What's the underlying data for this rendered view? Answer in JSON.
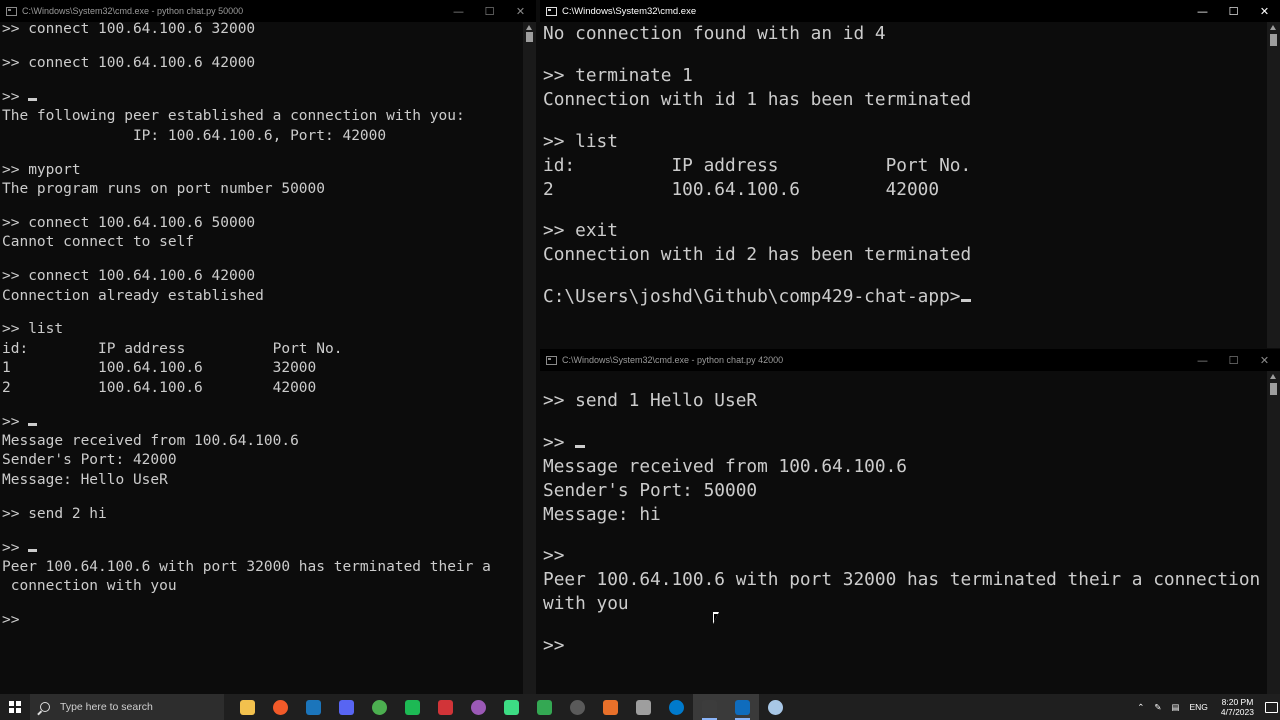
{
  "windows": {
    "left": {
      "title": "C:\\Windows\\System32\\cmd.exe - python  chat.py 50000",
      "controls": {
        "minimize": "—",
        "maximize": "☐",
        "close": "✕"
      },
      "lines": [
        ">> connect 100.64.100.6 32000",
        "",
        ">> connect 100.64.100.6 42000",
        "",
        ">> ",
        "The following peer established a connection with you:",
        "               IP: 100.64.100.6, Port: 42000",
        "",
        ">> myport",
        "The program runs on port number 50000",
        "",
        ">> connect 100.64.100.6 50000",
        "Cannot connect to self",
        "",
        ">> connect 100.64.100.6 42000",
        "Connection already established",
        "",
        ">> list",
        "id:        IP address          Port No.",
        "1          100.64.100.6        32000",
        "2          100.64.100.6        42000",
        "",
        ">> ",
        "Message received from 100.64.100.6",
        "Sender's Port: 42000",
        "Message: Hello UseR",
        "",
        ">> send 2 hi",
        "",
        ">> ",
        "Peer 100.64.100.6 with port 32000 has terminated their a",
        " connection with you",
        "",
        ">>"
      ]
    },
    "top_right": {
      "title": "C:\\Windows\\System32\\cmd.exe",
      "controls": {
        "minimize": "—",
        "maximize": "☐",
        "close": "✕"
      },
      "lines": [
        "No connection found with an id 4",
        "",
        ">> terminate 1",
        "Connection with id 1 has been terminated",
        "",
        ">> list",
        "id:         IP address          Port No.",
        "2           100.64.100.6        42000",
        "",
        ">> exit",
        "Connection with id 2 has been terminated",
        "",
        "C:\\Users\\joshd\\Github\\comp429-chat-app>"
      ]
    },
    "bottom_right": {
      "title": "C:\\Windows\\System32\\cmd.exe - python  chat.py 42000",
      "controls": {
        "minimize": "—",
        "maximize": "☐",
        "close": "✕"
      },
      "lines": [
        "",
        ">> send 1 Hello UseR",
        "",
        ">> ",
        "Message received from 100.64.100.6",
        "Sender's Port: 50000",
        "Message: hi",
        "",
        ">>",
        "Peer 100.64.100.6 with port 32000 has terminated their a connection",
        "with you",
        "",
        ">>"
      ]
    }
  },
  "taskbar": {
    "search_placeholder": "Type here to search",
    "apps": [
      {
        "icon": "file-explorer-icon",
        "color": "#f2c14e"
      },
      {
        "icon": "brave-browser-icon",
        "color": "#f25a29"
      },
      {
        "icon": "steam-icon",
        "color": "#1b75bb"
      },
      {
        "icon": "discord-icon",
        "color": "#5865f2"
      },
      {
        "icon": "chrome-icon",
        "color": "#4caf50"
      },
      {
        "icon": "spotify-icon",
        "color": "#1db954"
      },
      {
        "icon": "app-red-icon",
        "color": "#d13438"
      },
      {
        "icon": "app-purple-icon",
        "color": "#9b59b6"
      },
      {
        "icon": "android-studio-icon",
        "color": "#3ddc84"
      },
      {
        "icon": "chrome-alt-icon",
        "color": "#34a853"
      },
      {
        "icon": "app-dark-icon",
        "color": "#5a5a5a"
      },
      {
        "icon": "app-orange-icon",
        "color": "#e8702a"
      },
      {
        "icon": "app-gray-icon",
        "color": "#9e9e9e"
      },
      {
        "icon": "vscode-icon",
        "color": "#007acc"
      },
      {
        "icon": "command-prompt-icon",
        "color": "#3c3c3c",
        "active": true
      },
      {
        "icon": "app-blue-icon",
        "color": "#0f6cbd",
        "active": true
      },
      {
        "icon": "app-light-icon",
        "color": "#a8c7e6"
      }
    ],
    "tray": {
      "language": "ENG",
      "time": "8:20 PM",
      "date": "4/7/2023"
    }
  },
  "colors": {
    "console_bg": "#0c0c0c",
    "console_text": "#cccccc",
    "taskbar_bg": "#1f1f1f"
  }
}
